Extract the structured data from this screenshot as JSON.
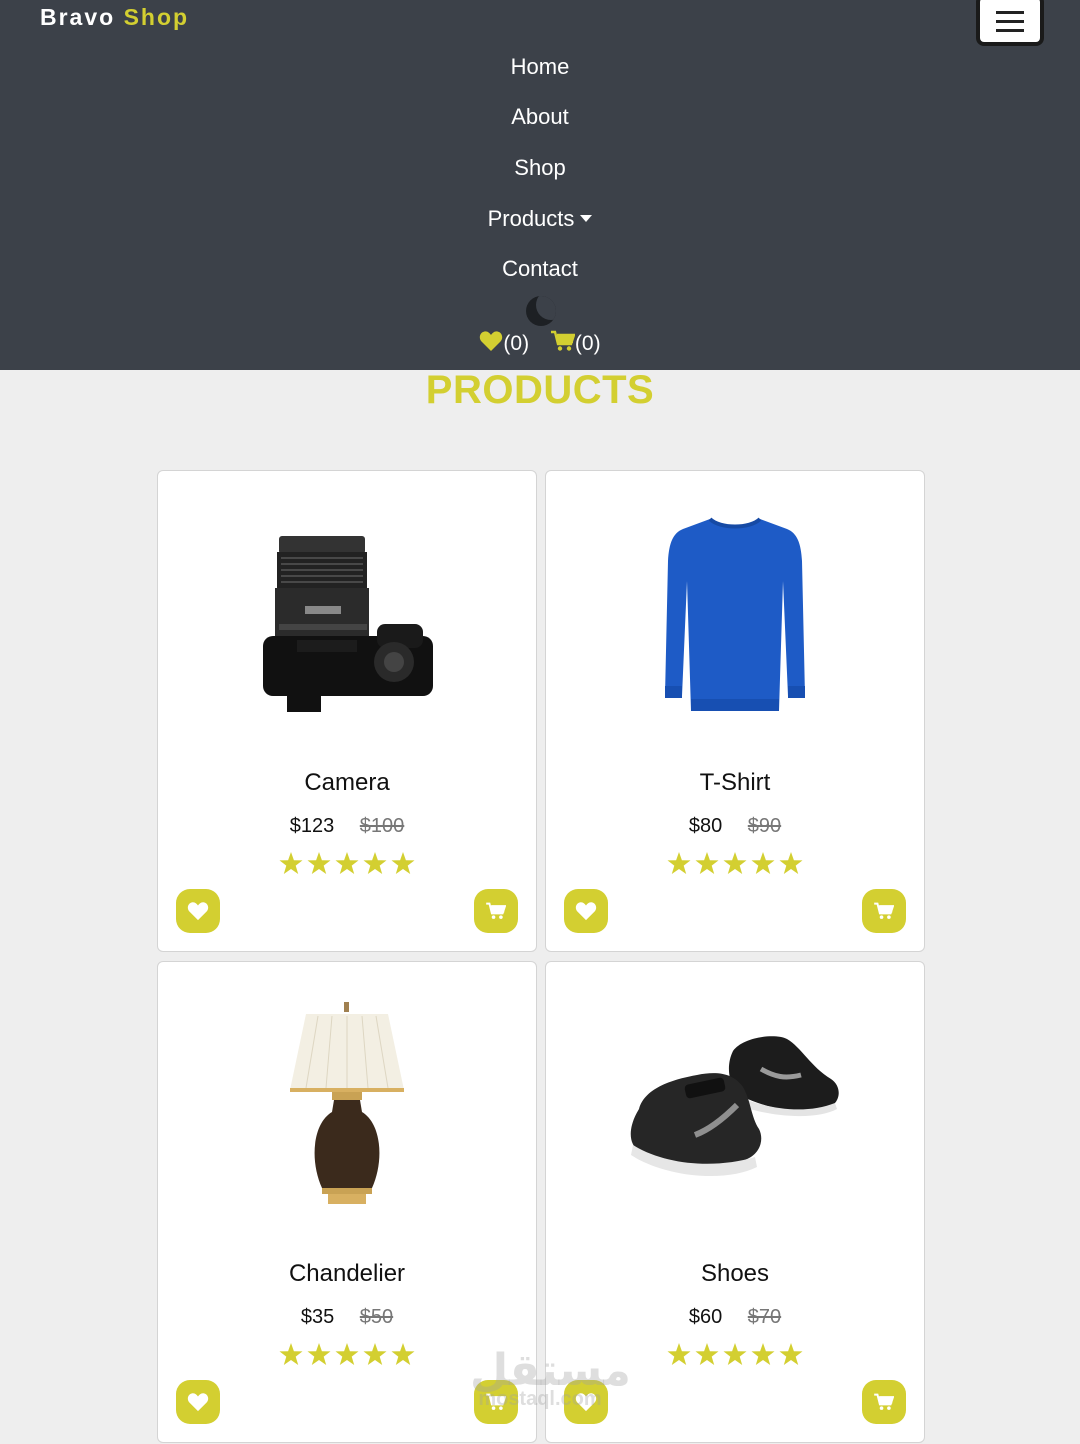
{
  "navbar": {
    "brand_first": "Bravo",
    "brand_second": "Shop",
    "links": [
      {
        "label": "Home"
      },
      {
        "label": "About"
      },
      {
        "label": "Shop"
      },
      {
        "label": "Products",
        "dropdown": true
      },
      {
        "label": "Contact"
      }
    ],
    "wishlist_count": "(0)",
    "cart_count": "(0)"
  },
  "section": {
    "title": "PRODUCTS"
  },
  "products": [
    {
      "name": "Camera",
      "price": "$123",
      "old_price": "$100",
      "rating": 5
    },
    {
      "name": "T-Shirt",
      "price": "$80",
      "old_price": "$90",
      "rating": 5
    },
    {
      "name": "Chandelier",
      "price": "$35",
      "old_price": "$50",
      "rating": 5
    },
    {
      "name": "Shoes",
      "price": "$60",
      "old_price": "$70",
      "rating": 5
    }
  ],
  "watermark": {
    "line1": "مستقل",
    "line2": "mostaql.com"
  },
  "colors": {
    "accent": "#d3cf31",
    "navbar_bg": "#3c4149",
    "page_bg": "#eeeeee"
  },
  "icons": {
    "wishlist": "heart-icon",
    "cart": "cart-icon",
    "theme": "moon-icon",
    "menu": "hamburger-icon",
    "rating": "star-icon"
  }
}
